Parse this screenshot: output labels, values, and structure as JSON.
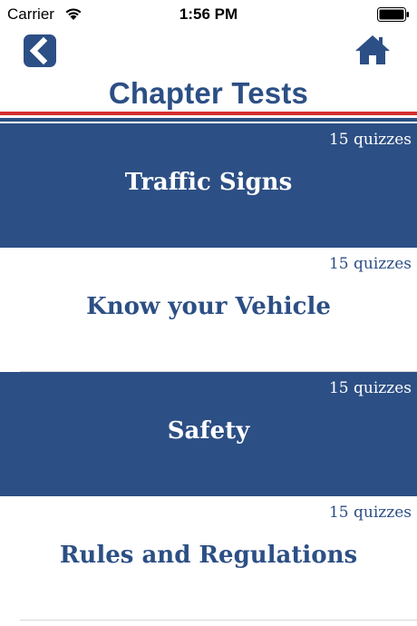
{
  "status_bar": {
    "carrier": "Carrier",
    "time": "1:56 PM"
  },
  "header": {
    "title": "Chapter Tests",
    "back_icon": "chevron-left-icon",
    "home_icon": "home-icon"
  },
  "colors": {
    "primary": "#2c4f85",
    "accent_red": "#d52d2d",
    "background": "#ffffff"
  },
  "chapters": [
    {
      "name": "Traffic Signs",
      "quizzes": "15 quizzes"
    },
    {
      "name": "Know your Vehicle",
      "quizzes": "15 quizzes"
    },
    {
      "name": "Safety",
      "quizzes": "15 quizzes"
    },
    {
      "name": "Rules and Regulations",
      "quizzes": "15 quizzes"
    }
  ]
}
